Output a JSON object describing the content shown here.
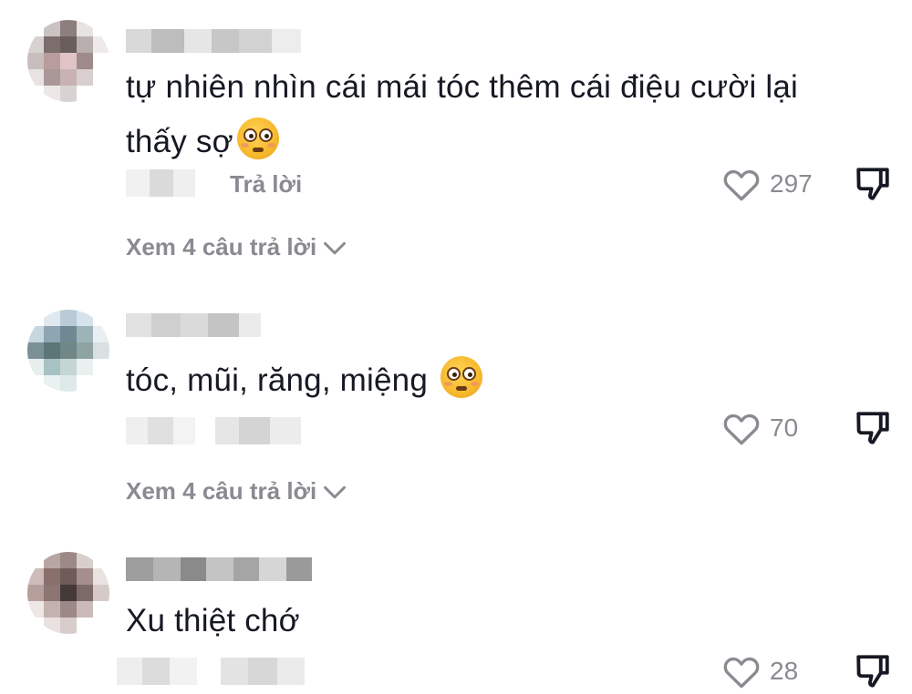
{
  "comments": [
    {
      "text": "tự nhiên nhìn cái mái tóc thêm cái điệu cười lại thấy sợ",
      "emoji": "flushed-face-icon",
      "reply_label": "Trả lời",
      "likes": "297",
      "view_replies": "Xem 4 câu trả lời",
      "avatar_colors": [
        "#ffffff",
        "#c9c3c1",
        "#8c7f7d",
        "#e7e3e2",
        "#ffffff",
        "#d8d2d1",
        "#7c6e6c",
        "#6a5d5c",
        "#b9afae",
        "#eeeaea",
        "#c7bebd",
        "#b79e9c",
        "#e2c4c6",
        "#9e8b8a",
        "#ffffff",
        "#e7e3e2",
        "#a99897",
        "#c8b2b3",
        "#d8cfce",
        "#ffffff",
        "#ffffff",
        "#ece8e8",
        "#d9d2d2",
        "#ffffff",
        "#ffffff"
      ]
    },
    {
      "text": "tóc, mũi, răng, miệng",
      "emoji": "flushed-face-icon",
      "likes": "70",
      "view_replies": "Xem 4 câu trả lời",
      "avatar_colors": [
        "#ffffff",
        "#dfe9ef",
        "#b8cbd7",
        "#d6e3ea",
        "#ffffff",
        "#c6d7df",
        "#8ea5b3",
        "#6f8994",
        "#9eb3b8",
        "#e8eef1",
        "#7a9095",
        "#5c7577",
        "#6f8786",
        "#8fa3a3",
        "#d8e0e2",
        "#e6eeee",
        "#a6c2c3",
        "#c4d5d3",
        "#eaf0ef",
        "#ffffff",
        "#ffffff",
        "#e9f1f1",
        "#dfe9e8",
        "#ffffff",
        "#ffffff"
      ]
    },
    {
      "text": "Xu thiệt chớ",
      "likes": "28",
      "avatar_colors": [
        "#ffffff",
        "#b8a6a4",
        "#9c8986",
        "#d8cfcd",
        "#ffffff",
        "#cdbcba",
        "#8a706d",
        "#6e5a57",
        "#a48f8c",
        "#e9e2e1",
        "#b59f9c",
        "#8d7571",
        "#45393a",
        "#7d6966",
        "#d6cac8",
        "#eee7e6",
        "#c4b2af",
        "#9c8987",
        "#cbbab8",
        "#ffffff",
        "#ffffff",
        "#e9e2e1",
        "#d8cdcb",
        "#ffffff",
        "#ffffff"
      ]
    }
  ],
  "colors": {
    "text_primary": "#161823",
    "text_secondary": "#8a8b91"
  }
}
